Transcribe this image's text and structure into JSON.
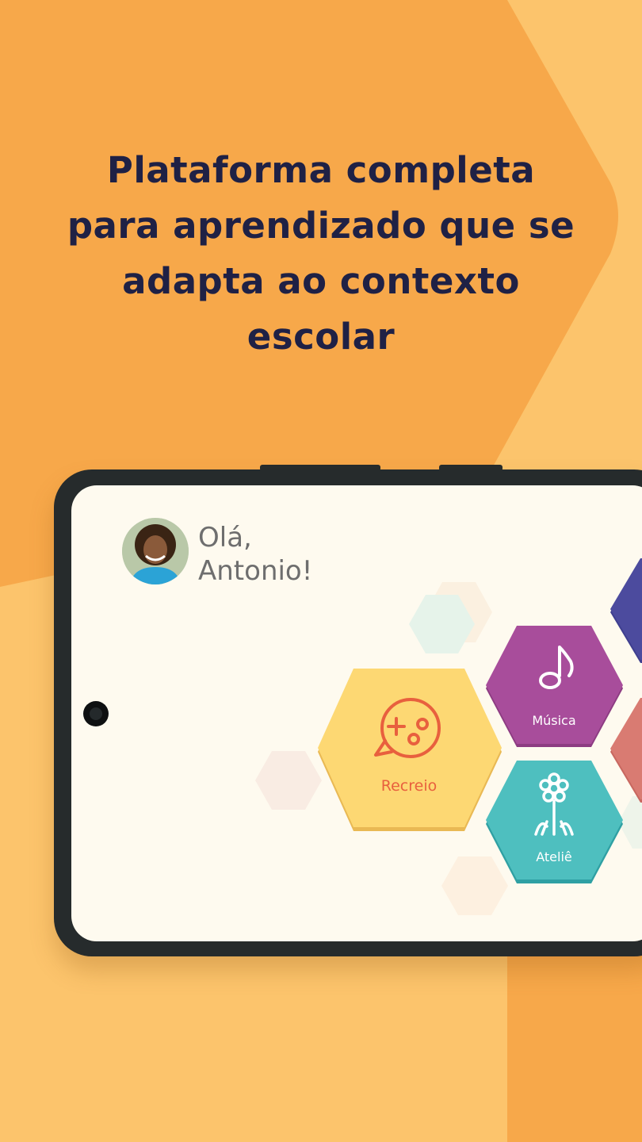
{
  "headline": {
    "lines": [
      "Plataforma completa",
      "para aprendizado que se",
      "adapta ao contexto",
      "escolar"
    ]
  },
  "app": {
    "greeting": {
      "line1": "Olá,",
      "line2": "Antonio!"
    },
    "tiles": [
      {
        "label": "Recreio",
        "icon": "game-chat-icon",
        "color": "#fdd873",
        "text_color": "#e8603e"
      },
      {
        "label": "Música",
        "icon": "music-note-icon",
        "color": "#a84d9b",
        "text_color": "#ffffff"
      },
      {
        "label": "Ateliê",
        "icon": "flower-icon",
        "color": "#4ebfbf",
        "text_color": "#ffffff"
      }
    ]
  },
  "colors": {
    "background": "#fcc46c",
    "accent_orange": "#f7a84a",
    "headline_text": "#1f2145",
    "screen_background": "#fefaef"
  }
}
